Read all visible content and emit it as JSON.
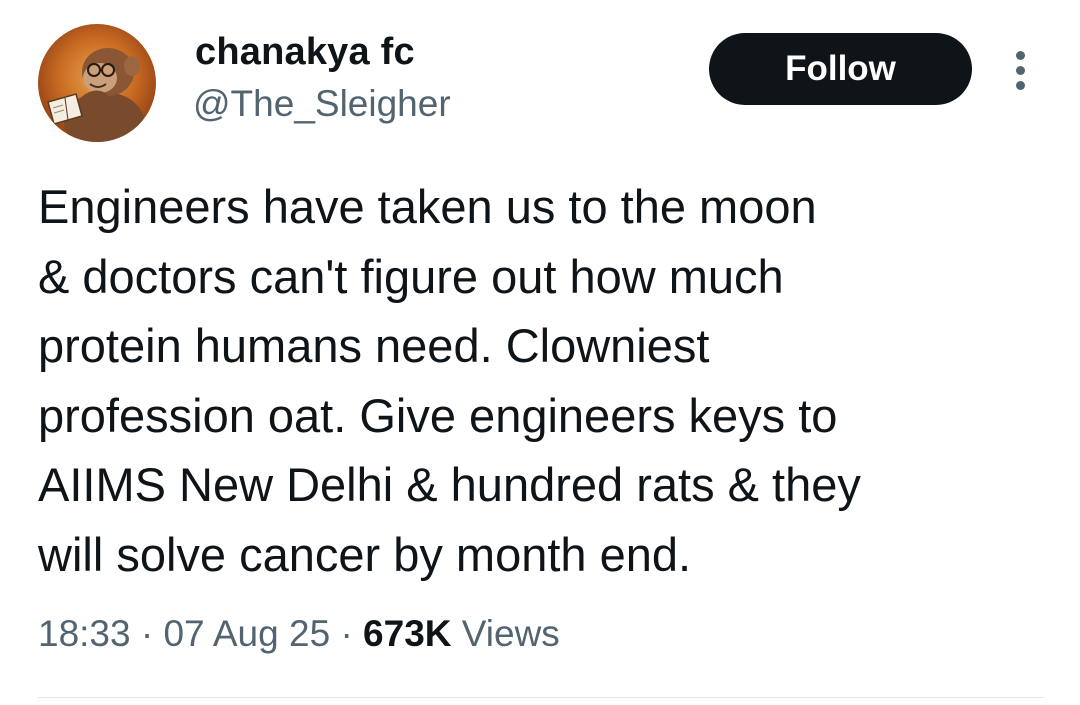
{
  "author": {
    "display_name": "chanakya fc",
    "handle": "@The_Sleigher",
    "avatar_icon": "monkey-reading-book-avatar"
  },
  "actions": {
    "follow_label": "Follow",
    "more_icon": "more-vertical-icon"
  },
  "tweet": {
    "lines": [
      "Engineers have taken us to the moon",
      "& doctors can't figure out how much",
      "protein humans need. Clowniest",
      "profession oat. Give engineers keys to",
      "AIIMS New Delhi & hundred rats & they",
      "will solve cancer by month end."
    ]
  },
  "meta": {
    "time": "18:33",
    "separator": "·",
    "date": "07 Aug 25",
    "views_count": "673K",
    "views_label": "Views"
  },
  "colors": {
    "text_primary": "#0f1419",
    "text_secondary": "#536471",
    "button_bg": "#0f1419",
    "button_text": "#ffffff",
    "divider": "#e4e8eb"
  }
}
